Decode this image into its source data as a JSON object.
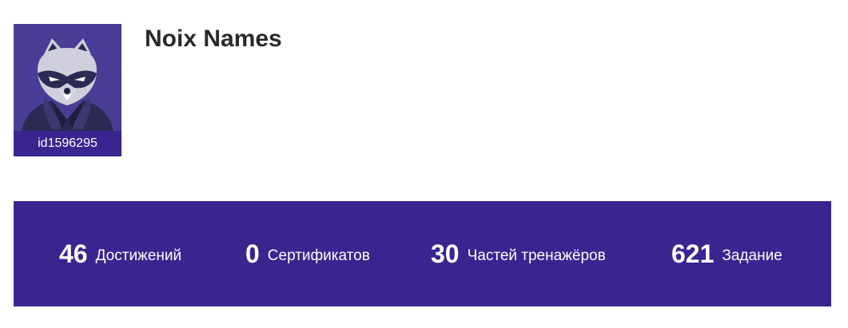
{
  "profile": {
    "name": "Noix Names",
    "user_id": "id1596295",
    "avatar_icon": "raccoon-avatar"
  },
  "stats": [
    {
      "value": "46",
      "label": "Достижений"
    },
    {
      "value": "0",
      "label": "Сертификатов"
    },
    {
      "value": "30",
      "label": "Частей тренажёров"
    },
    {
      "value": "621",
      "label": "Задание"
    }
  ],
  "colors": {
    "stats_background": "#3a2490",
    "avatar_background": "#4a3d96",
    "name_text": "#2a2a2a"
  }
}
